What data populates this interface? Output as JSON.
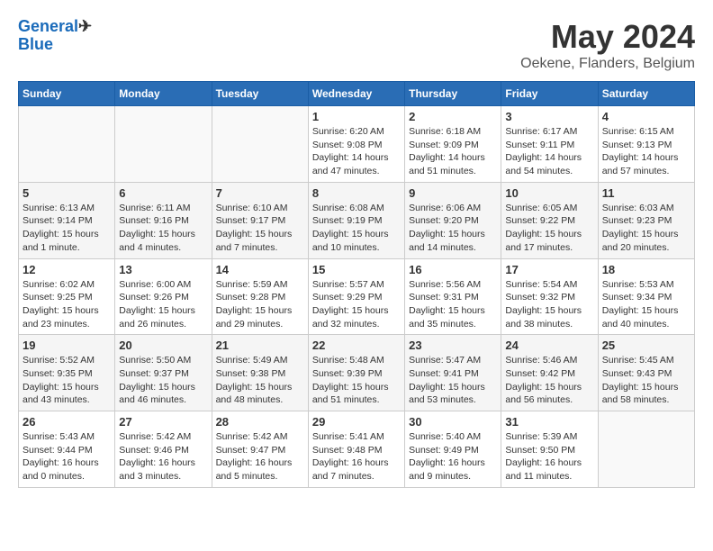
{
  "header": {
    "logo_text1": "General",
    "logo_text2": "Blue",
    "month_year": "May 2024",
    "location": "Oekene, Flanders, Belgium"
  },
  "weekdays": [
    "Sunday",
    "Monday",
    "Tuesday",
    "Wednesday",
    "Thursday",
    "Friday",
    "Saturday"
  ],
  "weeks": [
    [
      {
        "day": "",
        "info": ""
      },
      {
        "day": "",
        "info": ""
      },
      {
        "day": "",
        "info": ""
      },
      {
        "day": "1",
        "info": "Sunrise: 6:20 AM\nSunset: 9:08 PM\nDaylight: 14 hours\nand 47 minutes."
      },
      {
        "day": "2",
        "info": "Sunrise: 6:18 AM\nSunset: 9:09 PM\nDaylight: 14 hours\nand 51 minutes."
      },
      {
        "day": "3",
        "info": "Sunrise: 6:17 AM\nSunset: 9:11 PM\nDaylight: 14 hours\nand 54 minutes."
      },
      {
        "day": "4",
        "info": "Sunrise: 6:15 AM\nSunset: 9:13 PM\nDaylight: 14 hours\nand 57 minutes."
      }
    ],
    [
      {
        "day": "5",
        "info": "Sunrise: 6:13 AM\nSunset: 9:14 PM\nDaylight: 15 hours\nand 1 minute."
      },
      {
        "day": "6",
        "info": "Sunrise: 6:11 AM\nSunset: 9:16 PM\nDaylight: 15 hours\nand 4 minutes."
      },
      {
        "day": "7",
        "info": "Sunrise: 6:10 AM\nSunset: 9:17 PM\nDaylight: 15 hours\nand 7 minutes."
      },
      {
        "day": "8",
        "info": "Sunrise: 6:08 AM\nSunset: 9:19 PM\nDaylight: 15 hours\nand 10 minutes."
      },
      {
        "day": "9",
        "info": "Sunrise: 6:06 AM\nSunset: 9:20 PM\nDaylight: 15 hours\nand 14 minutes."
      },
      {
        "day": "10",
        "info": "Sunrise: 6:05 AM\nSunset: 9:22 PM\nDaylight: 15 hours\nand 17 minutes."
      },
      {
        "day": "11",
        "info": "Sunrise: 6:03 AM\nSunset: 9:23 PM\nDaylight: 15 hours\nand 20 minutes."
      }
    ],
    [
      {
        "day": "12",
        "info": "Sunrise: 6:02 AM\nSunset: 9:25 PM\nDaylight: 15 hours\nand 23 minutes."
      },
      {
        "day": "13",
        "info": "Sunrise: 6:00 AM\nSunset: 9:26 PM\nDaylight: 15 hours\nand 26 minutes."
      },
      {
        "day": "14",
        "info": "Sunrise: 5:59 AM\nSunset: 9:28 PM\nDaylight: 15 hours\nand 29 minutes."
      },
      {
        "day": "15",
        "info": "Sunrise: 5:57 AM\nSunset: 9:29 PM\nDaylight: 15 hours\nand 32 minutes."
      },
      {
        "day": "16",
        "info": "Sunrise: 5:56 AM\nSunset: 9:31 PM\nDaylight: 15 hours\nand 35 minutes."
      },
      {
        "day": "17",
        "info": "Sunrise: 5:54 AM\nSunset: 9:32 PM\nDaylight: 15 hours\nand 38 minutes."
      },
      {
        "day": "18",
        "info": "Sunrise: 5:53 AM\nSunset: 9:34 PM\nDaylight: 15 hours\nand 40 minutes."
      }
    ],
    [
      {
        "day": "19",
        "info": "Sunrise: 5:52 AM\nSunset: 9:35 PM\nDaylight: 15 hours\nand 43 minutes."
      },
      {
        "day": "20",
        "info": "Sunrise: 5:50 AM\nSunset: 9:37 PM\nDaylight: 15 hours\nand 46 minutes."
      },
      {
        "day": "21",
        "info": "Sunrise: 5:49 AM\nSunset: 9:38 PM\nDaylight: 15 hours\nand 48 minutes."
      },
      {
        "day": "22",
        "info": "Sunrise: 5:48 AM\nSunset: 9:39 PM\nDaylight: 15 hours\nand 51 minutes."
      },
      {
        "day": "23",
        "info": "Sunrise: 5:47 AM\nSunset: 9:41 PM\nDaylight: 15 hours\nand 53 minutes."
      },
      {
        "day": "24",
        "info": "Sunrise: 5:46 AM\nSunset: 9:42 PM\nDaylight: 15 hours\nand 56 minutes."
      },
      {
        "day": "25",
        "info": "Sunrise: 5:45 AM\nSunset: 9:43 PM\nDaylight: 15 hours\nand 58 minutes."
      }
    ],
    [
      {
        "day": "26",
        "info": "Sunrise: 5:43 AM\nSunset: 9:44 PM\nDaylight: 16 hours\nand 0 minutes."
      },
      {
        "day": "27",
        "info": "Sunrise: 5:42 AM\nSunset: 9:46 PM\nDaylight: 16 hours\nand 3 minutes."
      },
      {
        "day": "28",
        "info": "Sunrise: 5:42 AM\nSunset: 9:47 PM\nDaylight: 16 hours\nand 5 minutes."
      },
      {
        "day": "29",
        "info": "Sunrise: 5:41 AM\nSunset: 9:48 PM\nDaylight: 16 hours\nand 7 minutes."
      },
      {
        "day": "30",
        "info": "Sunrise: 5:40 AM\nSunset: 9:49 PM\nDaylight: 16 hours\nand 9 minutes."
      },
      {
        "day": "31",
        "info": "Sunrise: 5:39 AM\nSunset: 9:50 PM\nDaylight: 16 hours\nand 11 minutes."
      },
      {
        "day": "",
        "info": ""
      }
    ]
  ]
}
